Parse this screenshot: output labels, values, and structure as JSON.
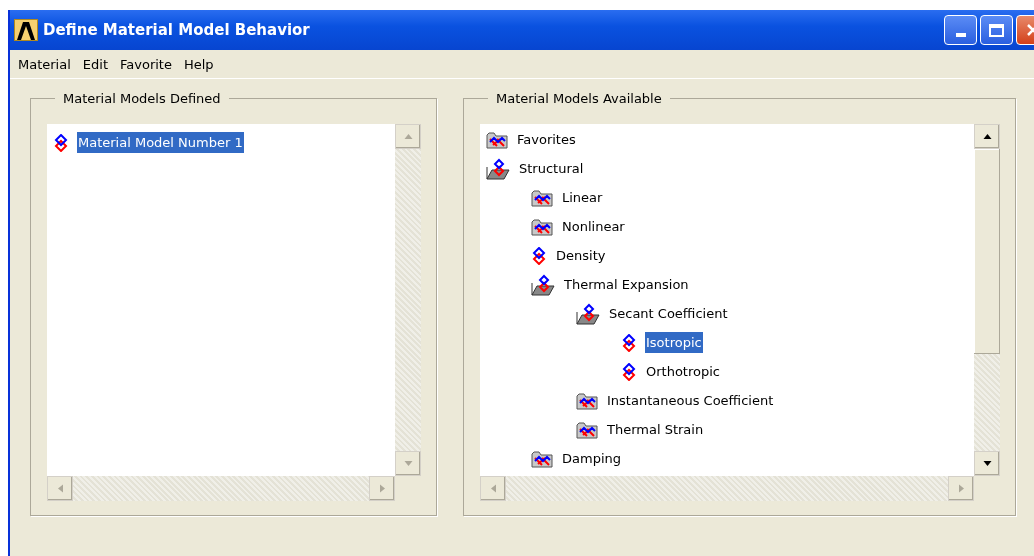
{
  "window": {
    "title": "Define Material Model Behavior"
  },
  "menu": [
    "Material",
    "Edit",
    "Favorite",
    "Help"
  ],
  "defined": {
    "title": "Material Models Defined",
    "items": [
      {
        "label": "Material Model Number 1",
        "kind": "leaf",
        "selected": true
      }
    ]
  },
  "available": {
    "title": "Material Models Available",
    "items": [
      {
        "label": "Favorites",
        "kind": "folder",
        "selected": false
      },
      {
        "label": "Structural",
        "kind": "folder-open",
        "selected": false,
        "children": [
          {
            "label": "Linear",
            "kind": "folder",
            "selected": false
          },
          {
            "label": "Nonlinear",
            "kind": "folder",
            "selected": false
          },
          {
            "label": "Density",
            "kind": "leaf",
            "selected": false
          },
          {
            "label": "Thermal Expansion",
            "kind": "folder-open",
            "selected": false,
            "children": [
              {
                "label": "Secant Coefficient",
                "kind": "folder-open",
                "selected": false,
                "children": [
                  {
                    "label": "Isotropic",
                    "kind": "leaf",
                    "selected": true
                  },
                  {
                    "label": "Orthotropic",
                    "kind": "leaf",
                    "selected": false
                  }
                ]
              },
              {
                "label": "Instantaneous Coefficient",
                "kind": "folder",
                "selected": false
              },
              {
                "label": "Thermal Strain",
                "kind": "folder",
                "selected": false
              }
            ]
          },
          {
            "label": "Damping",
            "kind": "folder",
            "selected": false
          }
        ]
      }
    ]
  }
}
